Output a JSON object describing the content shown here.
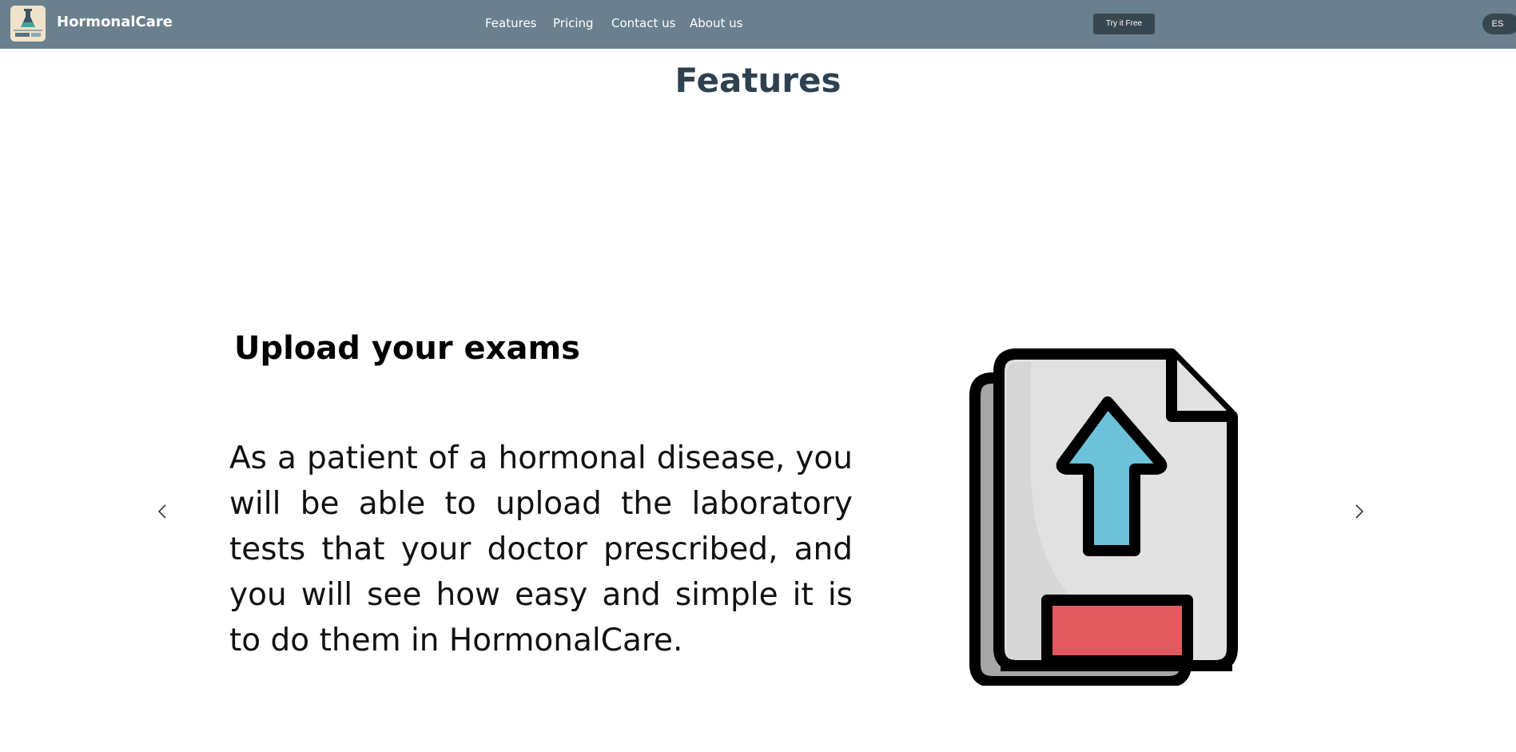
{
  "navbar": {
    "brand": "HormonalCare",
    "logo_icon": "flask-logo-icon",
    "links": [
      {
        "label": "Features"
      },
      {
        "label": "Pricing"
      },
      {
        "label": "Contact us"
      },
      {
        "label": "About us"
      }
    ],
    "cta_label": "Try it Free",
    "language_label": "ES"
  },
  "features": {
    "section_title": "Features",
    "slide": {
      "title": "Upload your exams",
      "text": "As a patient of a hormonal disease, you will be able to upload the laboratory tests that your doctor prescribed, and you will see how easy and simple it is to do them in HormonalCare.",
      "image_icon": "upload-document-icon"
    },
    "prev_icon": "chevron-left-icon",
    "next_icon": "chevron-right-icon"
  },
  "colors": {
    "navbar_bg": "#6a808e",
    "button_bg": "#37474f",
    "title_color": "#2e4150",
    "upload_arrow": "#6cc2da",
    "upload_bar": "#e05a5e"
  }
}
